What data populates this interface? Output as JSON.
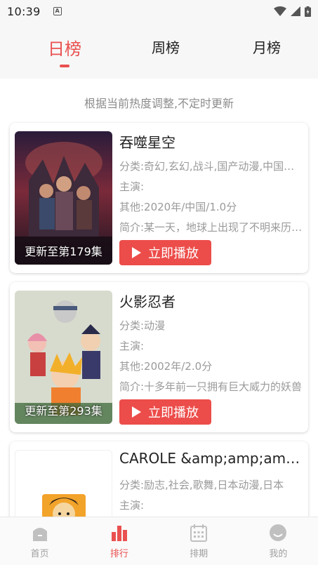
{
  "status_bar": {
    "time": "10:39",
    "badge": "A"
  },
  "tabs": [
    {
      "label": "日榜",
      "active": true
    },
    {
      "label": "周榜",
      "active": false
    },
    {
      "label": "月榜",
      "active": false
    }
  ],
  "subtitle": "根据当前热度调整,不定时更新",
  "play_label": "立即播放",
  "items": [
    {
      "title": "吞噬星空",
      "category": "分类:奇幻,玄幻,战斗,国产动漫,中国动漫",
      "cast": "主演:",
      "other": "其他:2020年/中国/1.0分",
      "intro": "简介:某一天，地球上出现了不明来历的生物",
      "update": "更新至第179集"
    },
    {
      "title": "火影忍者",
      "category": "分类:动漫",
      "cast": "主演:",
      "other": "其他:2002年/2.0分",
      "intro": "简介:十多年前一只拥有巨大威力的妖兽",
      "update": "更新至第293集"
    },
    {
      "title": "CAROLE &amp;amp;amp; TUESDAY",
      "category": "分类:励志,社会,歌舞,日本动漫,日本",
      "cast": "主演:"
    }
  ],
  "nav": [
    {
      "label": "首页",
      "icon": "home-icon",
      "active": false
    },
    {
      "label": "排行",
      "icon": "ranking-icon",
      "active": true
    },
    {
      "label": "排期",
      "icon": "calendar-icon",
      "active": false
    },
    {
      "label": "我的",
      "icon": "profile-icon",
      "active": false
    }
  ],
  "colors": {
    "accent": "#e9504f",
    "button": "#ec4d4a",
    "muted": "#9a9a9a"
  }
}
